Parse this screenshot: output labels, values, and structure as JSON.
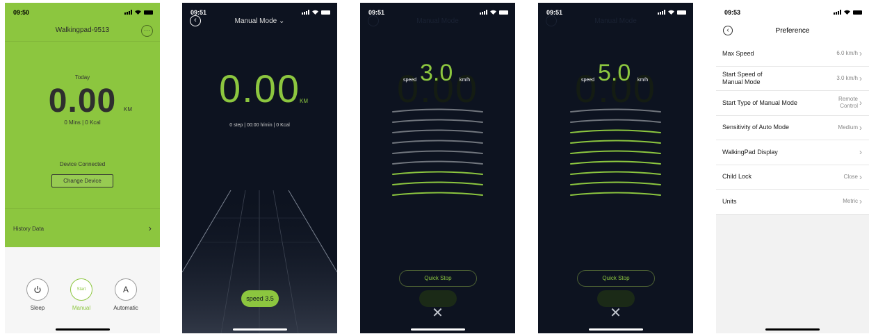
{
  "colors": {
    "accent": "#8cc63f",
    "dark_bg": "#0d1320",
    "light_bg": "#f2f2f2"
  },
  "screen1": {
    "time": "09:50",
    "device_name": "Walkingpad-9513",
    "more": "···",
    "today_label": "Today",
    "distance": "0.00",
    "unit": "KM",
    "summary": "0 Mins | 0 Kcal",
    "status": "Device Connected",
    "change_device": "Change Device",
    "history": "History Data",
    "modes": {
      "sleep": {
        "icon": "power-icon",
        "label": "Sleep"
      },
      "manual": {
        "icon": "start-circle",
        "icon_text": "Start",
        "label": "Manual"
      },
      "automatic": {
        "icon": "letter-a-icon",
        "icon_text": "A",
        "label": "Automatic"
      }
    }
  },
  "screen2": {
    "time": "09:51",
    "mode_title": "Manual Mode",
    "distance": "0.00",
    "unit": "KM",
    "summary": "0 step | 00:00 h/min | 0 Kcal",
    "speed_pill": "speed 3.5"
  },
  "screen3": {
    "time": "09:51",
    "speed_label": "speed",
    "speed_value": "3.0",
    "speed_unit": "km/h",
    "level": 3,
    "quick_stop": "Quick Stop"
  },
  "screen4": {
    "time": "09:51",
    "speed_label": "speed",
    "speed_value": "5.0",
    "speed_unit": "km/h",
    "level": 7,
    "quick_stop": "Quick Stop"
  },
  "screen5": {
    "time": "09:53",
    "title": "Preference",
    "items": [
      {
        "label": "Max Speed",
        "value": "6.0 km/h"
      },
      {
        "label": "Start Speed of Manual Mode",
        "value": "3.0 km/h"
      },
      {
        "label": "Start Type of Manual Mode",
        "value": "Remote Control"
      },
      {
        "label": "Sensitivity of Auto Mode",
        "value": "Medium"
      },
      {
        "label": "WalkingPad Display",
        "value": ""
      },
      {
        "label": "Child Lock",
        "value": "Close"
      },
      {
        "label": "Units",
        "value": "Metric"
      }
    ]
  }
}
